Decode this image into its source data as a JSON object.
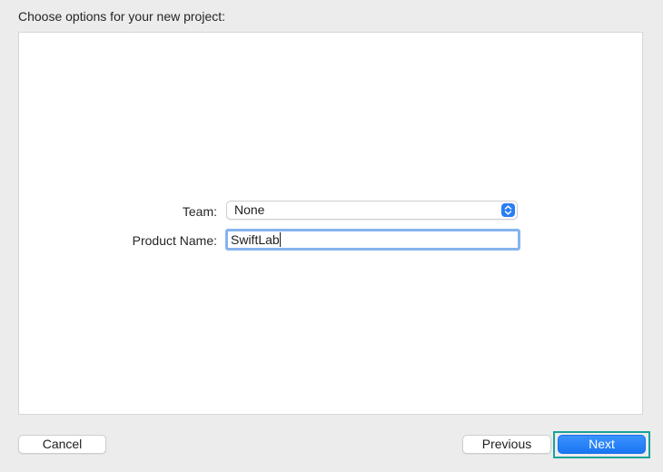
{
  "dialog": {
    "title": "Choose options for your new project:"
  },
  "form": {
    "team": {
      "label": "Team:",
      "value": "None"
    },
    "product_name": {
      "label": "Product Name:",
      "value": "SwiftLab"
    }
  },
  "buttons": {
    "cancel_label": "Cancel",
    "previous_label": "Previous",
    "next_label": "Next"
  },
  "colors": {
    "accent": "#2a7df5",
    "focus_ring": "#86b3ef",
    "highlight": "#1aa39a"
  }
}
